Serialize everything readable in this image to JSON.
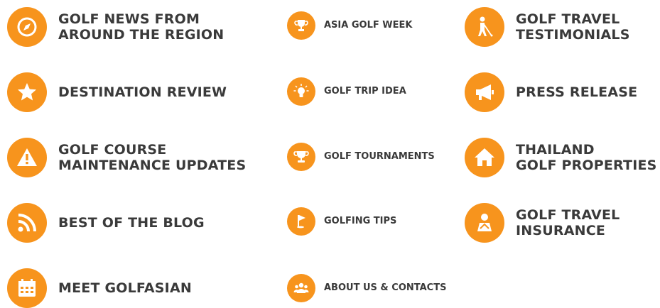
{
  "accent_color": "#f7941d",
  "text_color": "#3a3a3a",
  "menu": {
    "golf_news": {
      "label": "GOLF NEWS FROM\nAROUND THE REGION",
      "icon": "compass-icon"
    },
    "destination_review": {
      "label": "DESTINATION REVIEW",
      "icon": "star-icon"
    },
    "course_maintenance": {
      "label": "GOLF COURSE\nMAINTENANCE UPDATES",
      "icon": "warning-icon"
    },
    "best_of_blog": {
      "label": "BEST OF THE BLOG",
      "icon": "rss-icon"
    },
    "meet_golfasian": {
      "label": "MEET GOLFASIAN",
      "icon": "calendar-icon"
    },
    "asia_golf_week": {
      "label": "ASIA GOLF WEEK",
      "icon": "trophy-icon"
    },
    "golf_trip_idea": {
      "label": "GOLF TRIP IDEA",
      "icon": "lightbulb-icon"
    },
    "golf_tournaments": {
      "label": "GOLF TOURNAMENTS",
      "icon": "trophy-cup-icon"
    },
    "golfing_tips": {
      "label": "GOLFING TIPS",
      "icon": "flag-icon"
    },
    "about_us": {
      "label": "ABOUT US & CONTACTS",
      "icon": "group-icon"
    },
    "travel_testimonials": {
      "label": "GOLF TRAVEL\nTESTIMONIALS",
      "icon": "golfer-icon"
    },
    "press_release": {
      "label": "PRESS RELEASE",
      "icon": "megaphone-icon"
    },
    "thailand_properties": {
      "label": "THAILAND\nGOLF PROPERTIES",
      "icon": "house-icon"
    },
    "travel_insurance": {
      "label": "GOLF TRAVEL\nINSURANCE",
      "icon": "person-icon"
    }
  }
}
